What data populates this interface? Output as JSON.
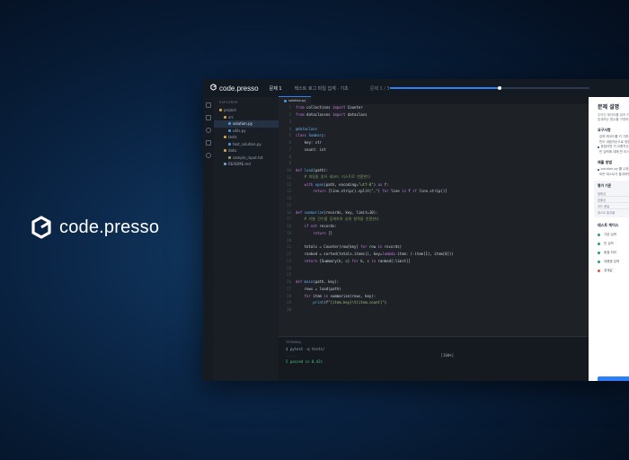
{
  "brand": {
    "name": "code.presso"
  },
  "topbar": {
    "logo_text": "code.presso",
    "problem_number": "문제 1",
    "problem_title": "텍스트 로그 파일 집계 · 기초",
    "problem_counter": "문제 1 / 3",
    "progress_percent": 55
  },
  "explorer": {
    "title": "EXPLORER",
    "items": [
      {
        "label": "project",
        "type": "folder",
        "depth": 0
      },
      {
        "label": "src",
        "type": "folder",
        "depth": 1
      },
      {
        "label": "solution.py",
        "type": "py",
        "depth": 2,
        "active": true
      },
      {
        "label": "utils.py",
        "type": "py",
        "depth": 2
      },
      {
        "label": "tests",
        "type": "folder",
        "depth": 1
      },
      {
        "label": "test_solution.py",
        "type": "py",
        "depth": 2
      },
      {
        "label": "data",
        "type": "folder",
        "depth": 1
      },
      {
        "label": "sample_input.txt",
        "type": "txt",
        "depth": 2
      },
      {
        "label": "README.md",
        "type": "md",
        "depth": 1
      }
    ]
  },
  "editor": {
    "tab_label": "solution.py",
    "lines": [
      {
        "n": "1",
        "segs": [
          [
            "kw",
            "from "
          ],
          [
            "tx",
            "collections "
          ],
          [
            "kw",
            "import "
          ],
          [
            "tx",
            "Counter"
          ]
        ]
      },
      {
        "n": "2",
        "segs": [
          [
            "kw",
            "from "
          ],
          [
            "tx",
            "dataclasses "
          ],
          [
            "kw",
            "import "
          ],
          [
            "tx",
            "dataclass"
          ]
        ]
      },
      {
        "n": "3",
        "segs": []
      },
      {
        "n": "4",
        "segs": [
          [
            "fn",
            "@dataclass"
          ]
        ]
      },
      {
        "n": "5",
        "segs": [
          [
            "kw",
            "class "
          ],
          [
            "fn",
            "Summary"
          ],
          [
            "tx",
            ":"
          ]
        ]
      },
      {
        "n": "6",
        "segs": [
          [
            "tx",
            "    key: str"
          ]
        ]
      },
      {
        "n": "7",
        "segs": [
          [
            "tx",
            "    count: int"
          ]
        ]
      },
      {
        "n": "8",
        "segs": []
      },
      {
        "n": "9",
        "segs": []
      },
      {
        "n": "10",
        "segs": [
          [
            "kw",
            "def "
          ],
          [
            "fn",
            "load"
          ],
          [
            "tx",
            "(path):"
          ]
        ]
      },
      {
        "n": "11",
        "segs": [
          [
            "cm",
            "    # 파일을 읽어 레코드 리스트로 반환한다"
          ]
        ]
      },
      {
        "n": "12",
        "segs": [
          [
            "kw",
            "    with "
          ],
          [
            "fn",
            "open"
          ],
          [
            "tx",
            "(path, encoding="
          ],
          [
            "str",
            "\"utf-8\""
          ],
          [
            "tx",
            ") "
          ],
          [
            "kw",
            "as "
          ],
          [
            "tx",
            "f:"
          ]
        ]
      },
      {
        "n": "13",
        "segs": [
          [
            "kw",
            "        return "
          ],
          [
            "tx",
            "[line.strip().split("
          ],
          [
            "str",
            "\",\""
          ],
          [
            "tx",
            ") "
          ],
          [
            "kw",
            "for "
          ],
          [
            "tx",
            "line "
          ],
          [
            "kw",
            "in "
          ],
          [
            "tx",
            "f "
          ],
          [
            "kw",
            "if "
          ],
          [
            "tx",
            "line.strip()]"
          ]
        ]
      },
      {
        "n": "14",
        "segs": []
      },
      {
        "n": "15",
        "segs": []
      },
      {
        "n": "16",
        "segs": [
          [
            "kw",
            "def "
          ],
          [
            "fn",
            "summarize"
          ],
          [
            "tx",
            "(records, key, limit=10):"
          ]
        ]
      },
      {
        "n": "17",
        "segs": [
          [
            "cm",
            "    # 키별 건수를 집계하여 상위 항목을 반환한다"
          ]
        ]
      },
      {
        "n": "18",
        "segs": [
          [
            "kw",
            "    if not "
          ],
          [
            "tx",
            "records:"
          ]
        ]
      },
      {
        "n": "19",
        "segs": [
          [
            "kw",
            "        return "
          ],
          [
            "tx",
            "[]"
          ]
        ]
      },
      {
        "n": "20",
        "segs": []
      },
      {
        "n": "21",
        "segs": [
          [
            "tx",
            "    totals = Counter(row[key] "
          ],
          [
            "kw",
            "for "
          ],
          [
            "tx",
            "row "
          ],
          [
            "kw",
            "in "
          ],
          [
            "tx",
            "records)"
          ]
        ]
      },
      {
        "n": "22",
        "segs": [
          [
            "tx",
            "    ranked = sorted(totals.items(), key="
          ],
          [
            "kw",
            "lambda "
          ],
          [
            "tx",
            "item: (-item[1], item[0]))"
          ]
        ]
      },
      {
        "n": "23",
        "segs": [
          [
            "kw",
            "    return "
          ],
          [
            "tx",
            "[Summary(k, c) "
          ],
          [
            "kw",
            "for "
          ],
          [
            "tx",
            "k, c "
          ],
          [
            "kw",
            "in "
          ],
          [
            "tx",
            "ranked[:limit]]"
          ]
        ]
      },
      {
        "n": "24",
        "segs": []
      },
      {
        "n": "25",
        "segs": []
      },
      {
        "n": "26",
        "segs": [
          [
            "kw",
            "def "
          ],
          [
            "fn",
            "main"
          ],
          [
            "tx",
            "(path, key):"
          ]
        ]
      },
      {
        "n": "27",
        "segs": [
          [
            "tx",
            "    rows = load(path)"
          ]
        ]
      },
      {
        "n": "28",
        "segs": [
          [
            "kw",
            "    for "
          ],
          [
            "tx",
            "item "
          ],
          [
            "kw",
            "in "
          ],
          [
            "tx",
            "summarize(rows, key):"
          ]
        ]
      },
      {
        "n": "29",
        "segs": [
          [
            "fn",
            "        print"
          ],
          [
            "tx",
            "(f"
          ],
          [
            "str",
            "\"{item.key}\\t{item.count}\""
          ],
          [
            "tx",
            ")"
          ]
        ]
      },
      {
        "n": "30",
        "segs": []
      }
    ]
  },
  "terminal": {
    "title": "TERMINAL",
    "command": "$ pytest -q tests/",
    "separator": "......",
    "percent": "[100%]",
    "result": "5 passed in 0.42s"
  },
  "panel": {
    "title": "문제 설명",
    "desc_1": "주어진 데이터를 읽어 키별 건수를",
    "desc_2": "집계하는 함수를 구현하세요.",
    "req_heading": "요구사항",
    "requirements": [
      "입력 레코드를 키 기준으로 집계",
      "빈도 내림차순으로 정렬",
      "동점이면 키 오름차순",
      "빈 입력에 대해 빈 리스트"
    ],
    "submit_heading": "제출 방법",
    "submit_items": [
      "solution.py 를 수정",
      "모든 테스트가 통과하면 제출"
    ],
    "criteria_heading": "평가 기준",
    "criteria": [
      "정확성",
      "효율성",
      "코드 품질",
      "테스트 통과율"
    ],
    "tests_heading": "테스트 케이스",
    "tests": [
      {
        "label": "기본 입력",
        "status": "pass"
      },
      {
        "label": "빈 입력",
        "status": "pass"
      },
      {
        "label": "동점 처리",
        "status": "pass"
      },
      {
        "label": "대용량 입력",
        "status": "pass"
      },
      {
        "label": "경계값",
        "status": "fail"
      }
    ],
    "colors": {
      "pass": "#22a55b",
      "fail": "#e0533d",
      "accent": "#2d7ff9"
    }
  }
}
